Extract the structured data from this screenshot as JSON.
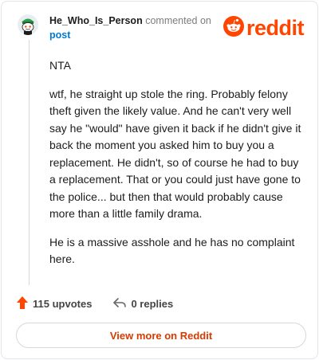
{
  "comment": {
    "author": "He_Who_Is_Person",
    "action_text": "commented on",
    "post_link": "post",
    "paragraphs": [
      "NTA",
      "wtf, he straight up stole the ring. Probably felony theft given the likely value. And he can't very well say he \"would\" have given it back if he didn't give it back the moment you asked him to buy you a replacement. He didn't, so of course he had to buy a replacement. That or you could just have gone to the police... but then that would probably cause more than a little family drama.",
      "He is a massive asshole and he has no complaint here."
    ],
    "upvotes": "115 upvotes",
    "replies": "0 replies"
  },
  "brand": {
    "logo_text": "reddit",
    "color": "#ff4500"
  },
  "footer": {
    "view_more_label": "View more on Reddit",
    "label_color": "#d93a00"
  },
  "icons": [
    "avatar-snoo",
    "reddit-snoo-icon",
    "upvote-arrow-icon",
    "reply-arrow-icon"
  ]
}
